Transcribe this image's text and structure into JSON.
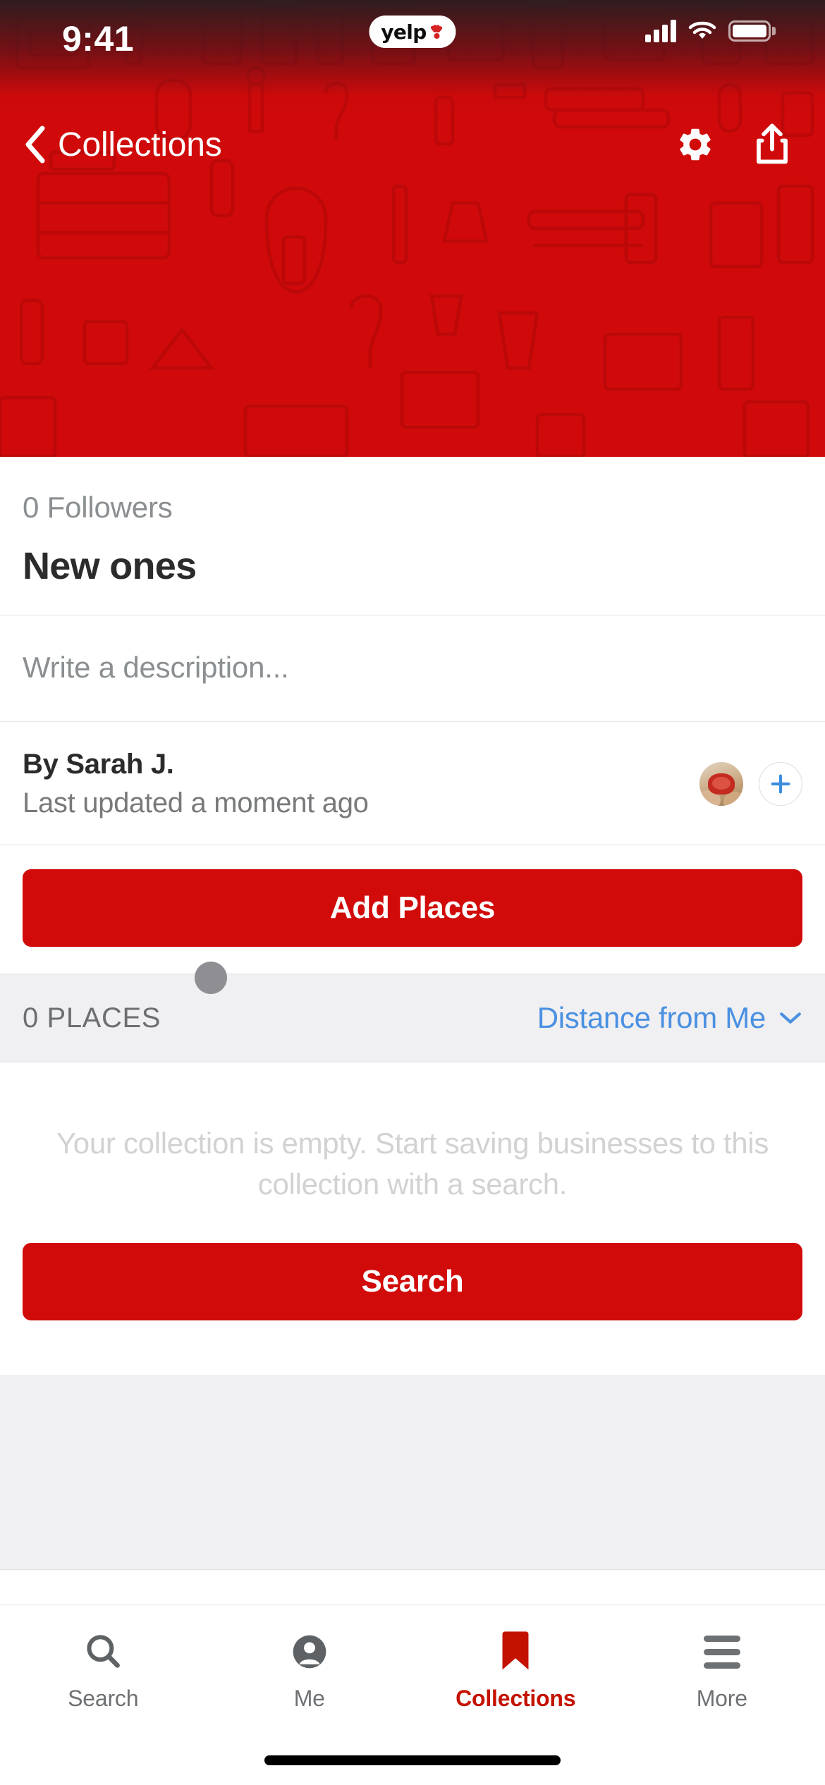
{
  "status_bar": {
    "time": "9:41",
    "logo_text": "yelp",
    "icons": [
      "cellular-signal-icon",
      "wifi-icon",
      "battery-icon"
    ]
  },
  "nav": {
    "back_label": "Collections",
    "back_icon": "chevron-left-icon",
    "settings_icon": "gear-icon",
    "share_icon": "share-upload-icon"
  },
  "collection": {
    "followers": "0 Followers",
    "title": "New ones",
    "description_placeholder": "Write a description...",
    "author": "By Sarah J.",
    "updated": "Last updated a moment ago",
    "add_contributor_icon": "plus-icon",
    "avatar_name": "user-avatar",
    "add_places_label": "Add Places"
  },
  "places_bar": {
    "count_label": "0 PLACES",
    "sort_label": "Distance from Me",
    "sort_icon": "chevron-down-icon"
  },
  "empty_state": {
    "message": "Your collection is empty. Start saving businesses to this collection with a search.",
    "search_label": "Search"
  },
  "tabs": [
    {
      "label": "Search",
      "icon": "search-icon",
      "active": false
    },
    {
      "label": "Me",
      "icon": "person-icon",
      "active": false
    },
    {
      "label": "Collections",
      "icon": "bookmark-icon",
      "active": true
    },
    {
      "label": "More",
      "icon": "hamburger-menu-icon",
      "active": false
    }
  ],
  "colors": {
    "brand_red": "#d10a0a",
    "active_tab_red": "#c41200",
    "link_blue": "#4a90e2",
    "muted_gray": "#8b8f91",
    "surface_gray": "#f0eff1"
  }
}
